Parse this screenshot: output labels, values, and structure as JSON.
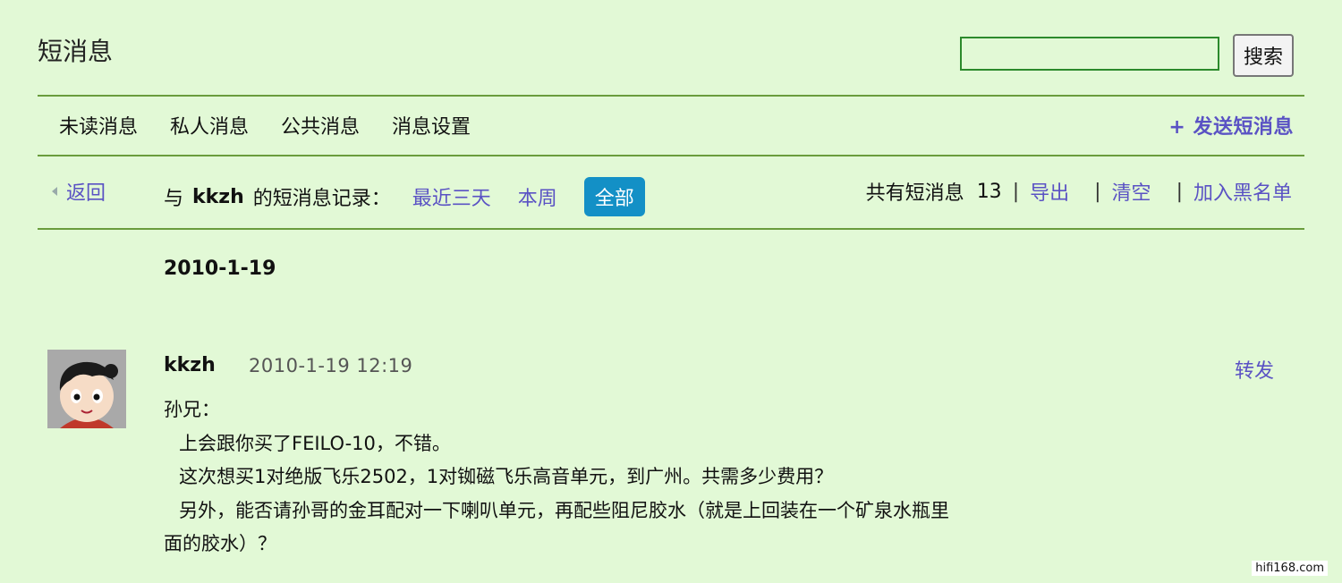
{
  "header": {
    "title": "短消息",
    "search_placeholder": "",
    "search_button": "搜索"
  },
  "tabs": [
    "未读消息",
    "私人消息",
    "公共消息",
    "消息设置"
  ],
  "send_link": "+ 发送短消息",
  "record_bar": {
    "back": "返回",
    "prefix": "与",
    "user": "kkzh",
    "suffix": "的短消息记录：",
    "filters": [
      "最近三天",
      "本周",
      "全部"
    ],
    "active_filter": "全部",
    "count_label": "共有短消息",
    "count": "13",
    "actions": [
      "导出",
      "清空",
      "加入黑名单"
    ]
  },
  "date_group": "2010-1-19",
  "message": {
    "author": "kkzh",
    "time": "2010-1-19 12:19",
    "forward": "转发",
    "lines": [
      "孙兄：",
      "上会跟你买了FEILO-10，不错。",
      "这次想买1对绝版飞乐2502，1对铷磁飞乐高音单元，到广州。共需多少费用？",
      "另外，能否请孙哥的金耳配对一下喇叭单元，再配些阻尼胶水（就是上回装在一个矿泉水瓶里",
      "面的胶水）？"
    ]
  },
  "watermark": "hifi168.com",
  "colors": {
    "background": "#e2f9d6",
    "link": "#5a52c4",
    "rule": "#6a9d3d",
    "active_filter_bg": "#1390c6"
  }
}
